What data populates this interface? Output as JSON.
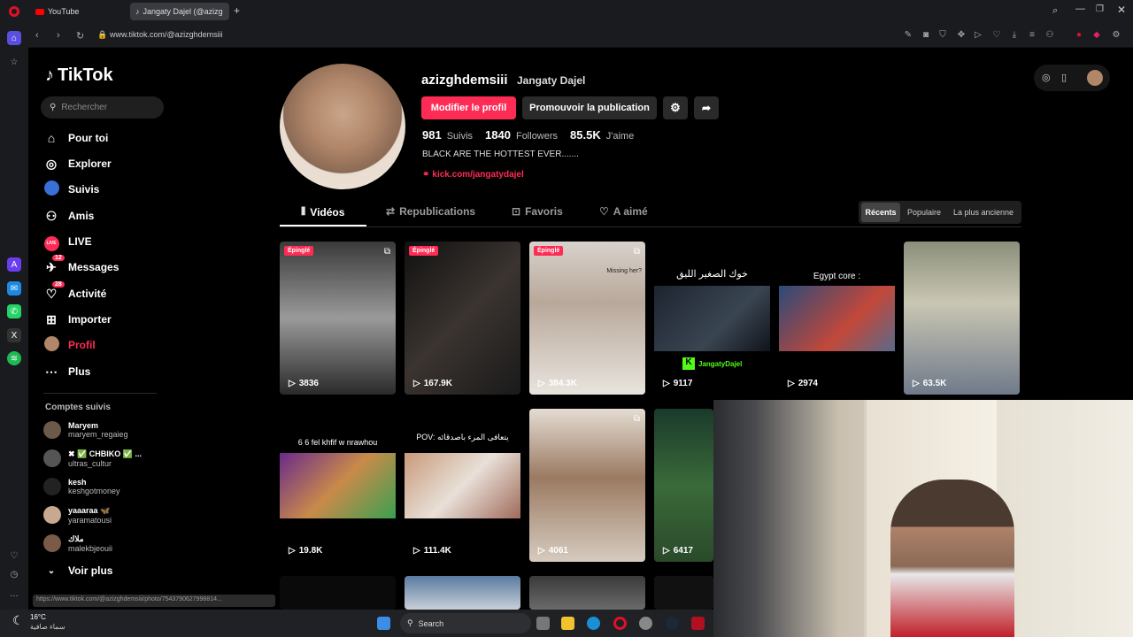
{
  "browser": {
    "tabs": [
      {
        "label": "YouTube"
      },
      {
        "label": "Jangaty Dajel (@azizg"
      }
    ],
    "url": "www.tiktok.com/@azizghdemsiii",
    "status_url": "https://www.tiktok.com/@azizghdemsiii/photo/7543790627998814..."
  },
  "sidebar": {
    "logo": "TikTok",
    "search_placeholder": "Rechercher",
    "nav": [
      {
        "label": "Pour toi",
        "icon": "home-icon"
      },
      {
        "label": "Explorer",
        "icon": "compass-icon"
      },
      {
        "label": "Suivis",
        "icon": "following-icon"
      },
      {
        "label": "Amis",
        "icon": "friends-icon"
      },
      {
        "label": "LIVE",
        "icon": "live-icon"
      },
      {
        "label": "Messages",
        "icon": "messages-icon",
        "badge": "12"
      },
      {
        "label": "Activité",
        "icon": "activity-icon",
        "badge": "28"
      },
      {
        "label": "Importer",
        "icon": "upload-icon"
      },
      {
        "label": "Profil",
        "icon": "profile-icon"
      },
      {
        "label": "Plus",
        "icon": "more-icon"
      }
    ],
    "following_title": "Comptes suivis",
    "following": [
      {
        "name": "Maryem",
        "handle": "maryem_regaieg"
      },
      {
        "name": "✖ ✅ CHBIKO ✅ ...",
        "handle": "ultras_cultur"
      },
      {
        "name": "kesh",
        "handle": "keshgotmoney"
      },
      {
        "name": "yaaaraa 🦋",
        "handle": "yaramatousi"
      },
      {
        "name": "ملاك",
        "handle": "malekbjeouii"
      }
    ],
    "see_more": "Voir plus"
  },
  "profile": {
    "username": "azizghdemsiii",
    "display_name": "Jangaty Dajel",
    "edit_button": "Modifier le profil",
    "promote_button": "Promouvoir la publication",
    "following_count": "981",
    "following_label": "Suivis",
    "followers_count": "1840",
    "followers_label": "Followers",
    "likes_count": "85.5K",
    "likes_label": "J'aime",
    "bio": "BLACK ARE THE HOTTEST EVER.......",
    "link": "kick.com/jangatydajel"
  },
  "tabs": [
    "Vidéos",
    "Republications",
    "Favoris",
    "A aimé"
  ],
  "sort": [
    "Récents",
    "Populaire",
    "La plus ancienne"
  ],
  "videos": [
    {
      "views": "3836",
      "pinned": "Épinglé",
      "caption": ""
    },
    {
      "views": "167.9K",
      "pinned": "Épinglé",
      "caption": ""
    },
    {
      "views": "384.3K",
      "pinned": "Épinglé",
      "caption": "Missing her?"
    },
    {
      "views": "9117",
      "pinned": "",
      "caption": "خوك الصغير الليق",
      "sub": "JangatyDajel"
    },
    {
      "views": "2974",
      "pinned": "",
      "caption": "Egypt core :"
    },
    {
      "views": "63.5K",
      "pinned": "",
      "caption": ""
    },
    {
      "views": "19.8K",
      "pinned": "",
      "caption": "6 6 fel khfif w nrawhou"
    },
    {
      "views": "111.4K",
      "pinned": "",
      "caption": "POV: يتعافى المرء باصدقائه"
    },
    {
      "views": "4061",
      "pinned": "",
      "caption": ""
    },
    {
      "views": "6417",
      "pinned": "",
      "caption": ""
    }
  ],
  "taskbar": {
    "weather_temp": "16°C",
    "weather_desc": "سماء صافية",
    "search": "Search"
  },
  "colors": {
    "accent": "#fe2c55",
    "link": "#fe2c55"
  }
}
